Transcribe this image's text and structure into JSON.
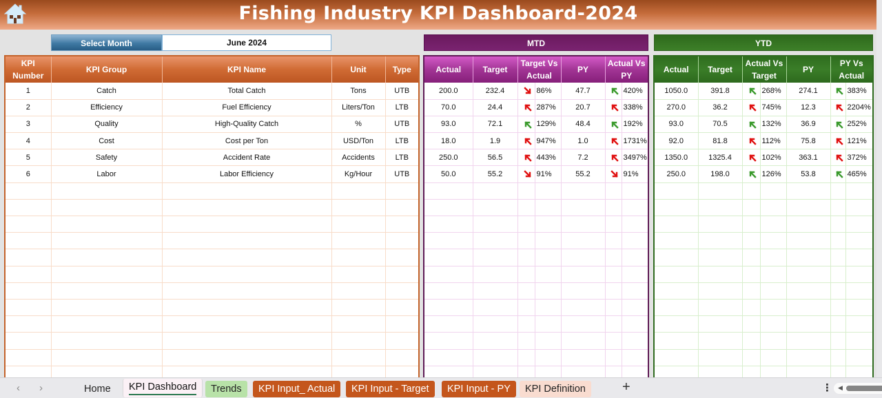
{
  "title": "Fishing Industry KPI Dashboard-2024",
  "home_icon": "home-icon",
  "select_month": {
    "label": "Select Month",
    "value": "June 2024"
  },
  "sections": {
    "mtd": "MTD",
    "ytd": "YTD"
  },
  "colors": {
    "up_good": "#3a9a2c",
    "up_bad": "#e01010",
    "down_bad": "#e01010",
    "kpi_header": "#c3622a",
    "mtd_header": "#8a227e",
    "ytd_header": "#2f6b1f"
  },
  "kpi_table": {
    "headers": [
      "KPI Number",
      "KPI Group",
      "KPI Name",
      "Unit",
      "Type"
    ],
    "rows": [
      {
        "num": "1",
        "group": "Catch",
        "name": "Total Catch",
        "unit": "Tons",
        "type": "UTB"
      },
      {
        "num": "2",
        "group": "Efficiency",
        "name": "Fuel Efficiency",
        "unit": "Liters/Ton",
        "type": "LTB"
      },
      {
        "num": "3",
        "group": "Quality",
        "name": "High-Quality Catch",
        "unit": "%",
        "type": "UTB"
      },
      {
        "num": "4",
        "group": "Cost",
        "name": "Cost per Ton",
        "unit": "USD/Ton",
        "type": "LTB"
      },
      {
        "num": "5",
        "group": "Safety",
        "name": "Accident Rate",
        "unit": "Accidents",
        "type": "LTB"
      },
      {
        "num": "6",
        "group": "Labor",
        "name": "Labor Efficiency",
        "unit": "Kg/Hour",
        "type": "UTB"
      }
    ]
  },
  "mtd_table": {
    "headers": [
      "Actual",
      "Target",
      "Target Vs Actual",
      "PY",
      "Actual Vs PY"
    ],
    "rows": [
      {
        "actual": "200.0",
        "target": "232.4",
        "tva_icon": "down-red",
        "tva": "86%",
        "py": "47.7",
        "avp_icon": "up-green",
        "avp": "420%"
      },
      {
        "actual": "70.0",
        "target": "24.4",
        "tva_icon": "up-red",
        "tva": "287%",
        "py": "20.7",
        "avp_icon": "up-red",
        "avp": "338%"
      },
      {
        "actual": "93.0",
        "target": "72.1",
        "tva_icon": "up-green",
        "tva": "129%",
        "py": "48.4",
        "avp_icon": "up-green",
        "avp": "192%"
      },
      {
        "actual": "18.0",
        "target": "1.9",
        "tva_icon": "up-red",
        "tva": "947%",
        "py": "1.0",
        "avp_icon": "up-red",
        "avp": "1731%"
      },
      {
        "actual": "250.0",
        "target": "56.5",
        "tva_icon": "up-red",
        "tva": "443%",
        "py": "7.2",
        "avp_icon": "up-red",
        "avp": "3497%"
      },
      {
        "actual": "50.0",
        "target": "55.2",
        "tva_icon": "down-red",
        "tva": "91%",
        "py": "55.2",
        "avp_icon": "down-red",
        "avp": "91%"
      }
    ]
  },
  "ytd_table": {
    "headers": [
      "Actual",
      "Target",
      "Actual Vs Target",
      "PY",
      "PY Vs Actual"
    ],
    "rows": [
      {
        "actual": "1050.0",
        "target": "391.8",
        "avt_icon": "up-green",
        "avt": "268%",
        "py": "274.1",
        "pva_icon": "up-green",
        "pva": "383%"
      },
      {
        "actual": "270.0",
        "target": "36.2",
        "avt_icon": "up-red",
        "avt": "745%",
        "py": "12.3",
        "pva_icon": "up-red",
        "pva": "2204%"
      },
      {
        "actual": "93.0",
        "target": "70.5",
        "avt_icon": "up-green",
        "avt": "132%",
        "py": "36.9",
        "pva_icon": "up-green",
        "pva": "252%"
      },
      {
        "actual": "92.0",
        "target": "81.8",
        "avt_icon": "up-red",
        "avt": "112%",
        "py": "75.8",
        "pva_icon": "up-red",
        "pva": "121%"
      },
      {
        "actual": "1350.0",
        "target": "1325.4",
        "avt_icon": "up-red",
        "avt": "102%",
        "py": "363.1",
        "pva_icon": "up-red",
        "pva": "372%"
      },
      {
        "actual": "250.0",
        "target": "198.0",
        "avt_icon": "up-green",
        "avt": "126%",
        "py": "53.8",
        "pva_icon": "up-green",
        "pva": "465%"
      }
    ]
  },
  "sheet_tabs": {
    "prev": "‹",
    "next": "›",
    "items": [
      {
        "label": "Home"
      },
      {
        "label": "KPI Dashboard",
        "active": true
      },
      {
        "label": "Trends"
      },
      {
        "label": "KPI Input_ Actual"
      },
      {
        "label": "KPI Input - Target"
      },
      {
        "label": "KPI Input - PY"
      },
      {
        "label": "KPI Definition"
      }
    ],
    "add": "+",
    "more": "⋮"
  }
}
